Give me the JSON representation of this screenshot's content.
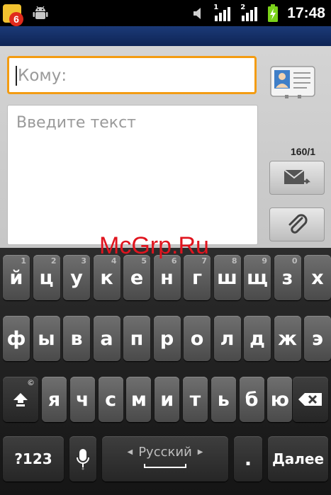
{
  "status_bar": {
    "notification_count": "6",
    "time": "17:48",
    "sim1_label": "1",
    "sim2_label": "2",
    "battery_color": "#7bd31a"
  },
  "compose": {
    "to_placeholder": "Кому:",
    "text_placeholder": "Введите текст",
    "counter": "160/1"
  },
  "watermark": "McGrp.Ru",
  "keyboard": {
    "row1": [
      {
        "label": "й",
        "hint": "1"
      },
      {
        "label": "ц",
        "hint": "2"
      },
      {
        "label": "у",
        "hint": "3"
      },
      {
        "label": "к",
        "hint": "4"
      },
      {
        "label": "е",
        "hint": "5"
      },
      {
        "label": "н",
        "hint": "6"
      },
      {
        "label": "г",
        "hint": "7"
      },
      {
        "label": "ш",
        "hint": "8"
      },
      {
        "label": "щ",
        "hint": "9"
      },
      {
        "label": "з",
        "hint": "0"
      },
      {
        "label": "х",
        "hint": ""
      }
    ],
    "row2": [
      "ф",
      "ы",
      "в",
      "а",
      "п",
      "р",
      "о",
      "л",
      "д",
      "ж",
      "э"
    ],
    "row3": [
      "я",
      "ч",
      "с",
      "м",
      "и",
      "т",
      "ь",
      "б",
      "ю"
    ],
    "shift_hint": "©",
    "symbols_label": "?123",
    "language_label": "Русский",
    "period_label": ".",
    "done_label": "Далее"
  }
}
